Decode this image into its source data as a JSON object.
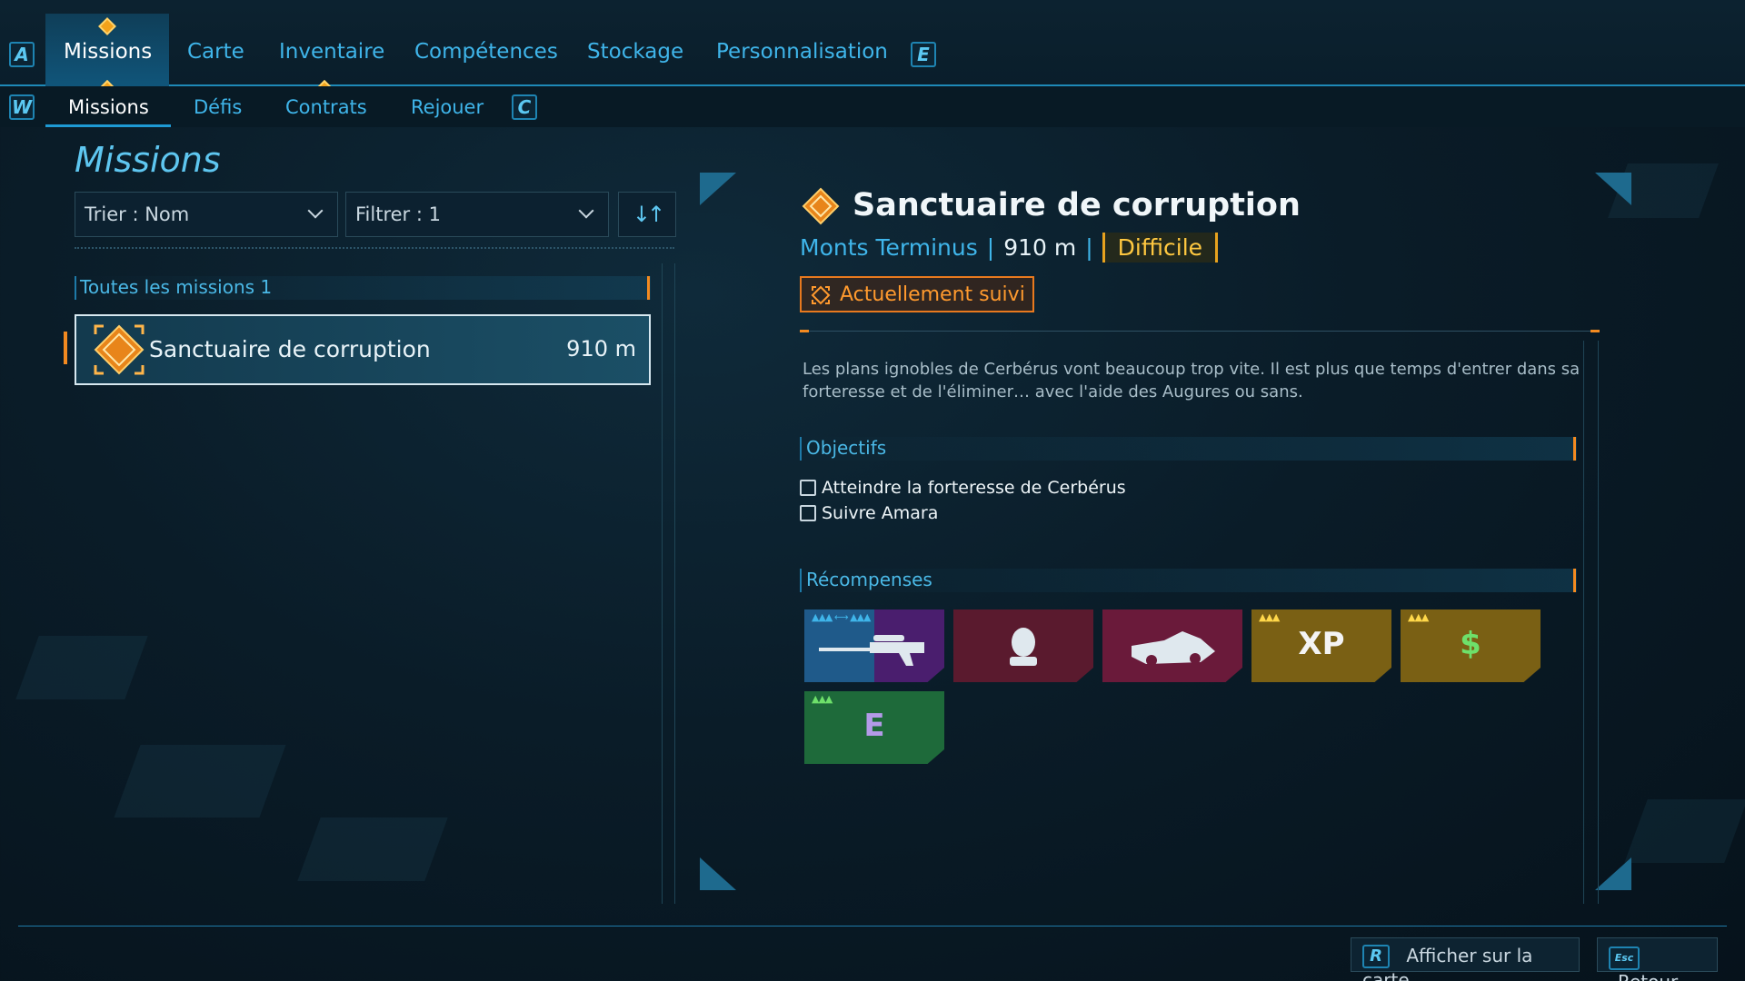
{
  "topnav": {
    "key_left": "A",
    "key_right": "E",
    "tabs": [
      {
        "label": "Missions"
      },
      {
        "label": "Carte"
      },
      {
        "label": "Inventaire"
      },
      {
        "label": "Compétences"
      },
      {
        "label": "Stockage"
      },
      {
        "label": "Personnalisation"
      }
    ]
  },
  "subnav": {
    "key_left": "W",
    "key_right": "C",
    "tabs": [
      {
        "label": "Missions"
      },
      {
        "label": "Défis"
      },
      {
        "label": "Contrats"
      },
      {
        "label": "Rejouer"
      }
    ]
  },
  "list_panel": {
    "title": "Missions",
    "sort_label": "Trier : Nom",
    "filter_label": "Filtrer : 1",
    "section_label": "Toutes les missions 1",
    "missions": [
      {
        "name": "Sanctuaire de corruption",
        "distance": "910 m"
      }
    ]
  },
  "detail": {
    "title": "Sanctuaire de corruption",
    "location": "Monts Terminus",
    "distance": "910 m",
    "difficulty": "Difficile",
    "tracked_label": "Actuellement suivi",
    "description": "Les plans ignobles de Cerbérus vont beaucoup trop vite. Il est plus que temps d'entrer dans sa forteresse et de l'éliminer… avec l'aide des Augures ou sans.",
    "objectives_label": "Objectifs",
    "objectives": [
      {
        "text": "Atteindre la forteresse de Cerbérus"
      },
      {
        "text": "Suivre Amara"
      }
    ],
    "rewards_label": "Récompenses",
    "rewards": [
      {
        "icon": "sniper-rifle-icon",
        "color": "#2a6a9a"
      },
      {
        "icon": "character-head-icon",
        "color": "#5a1a2e"
      },
      {
        "icon": "vehicle-icon",
        "color": "#6a1a3a"
      },
      {
        "icon": "xp-icon",
        "text": "XP",
        "color": "#7a6014"
      },
      {
        "icon": "cash-icon",
        "text": "$",
        "color": "#7a6014"
      },
      {
        "icon": "eridium-icon",
        "text": "E",
        "color": "#1e6a3a"
      }
    ]
  },
  "footer": {
    "map_key": "R",
    "map_label": "Afficher sur la carte",
    "back_key": "Esc",
    "back_label": "Retour"
  },
  "colors": {
    "accent_blue": "#3fb5ea",
    "accent_orange": "#f38a20",
    "difficulty_yellow": "#ffc840"
  }
}
